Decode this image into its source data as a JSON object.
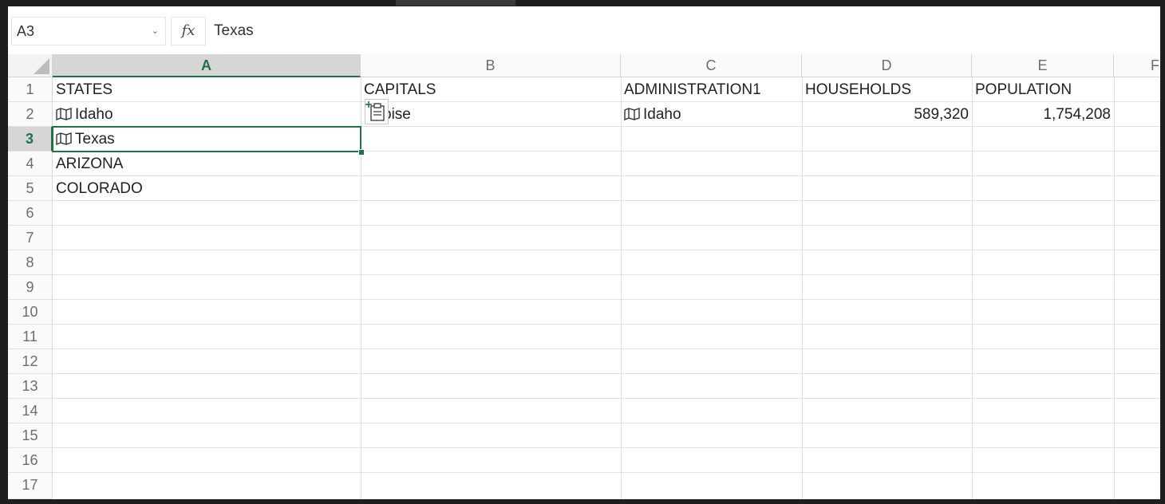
{
  "formula_bar": {
    "name_box": "A3",
    "fx_label": "fx",
    "formula": "Texas"
  },
  "columns": [
    {
      "letter": "A",
      "active": true
    },
    {
      "letter": "B",
      "active": false
    },
    {
      "letter": "C",
      "active": false
    },
    {
      "letter": "D",
      "active": false
    },
    {
      "letter": "E",
      "active": false
    },
    {
      "letter": "F",
      "active": false
    }
  ],
  "rows": [
    "1",
    "2",
    "3",
    "4",
    "5",
    "6",
    "7",
    "8",
    "9",
    "10",
    "11",
    "12",
    "13",
    "14",
    "15",
    "16",
    "17"
  ],
  "active_row": "3",
  "cells": {
    "A1": "STATES",
    "B1": "CAPITALS",
    "C1": "ADMINISTRATION1",
    "D1": "HOUSEHOLDS",
    "E1": "POPULATION",
    "A2": "Idaho",
    "B2": "oise",
    "C2": "Idaho",
    "D2": "589,320",
    "E2": "1,754,208",
    "A3": "Texas",
    "A4": "ARIZONA",
    "A5": "COLORADO"
  },
  "icons": {
    "geography_data_type": "map-icon",
    "paste_options": "paste-options-icon"
  },
  "colors": {
    "accent": "#217346",
    "gridline": "#e1e1e1",
    "header_bg": "#fafafa"
  }
}
